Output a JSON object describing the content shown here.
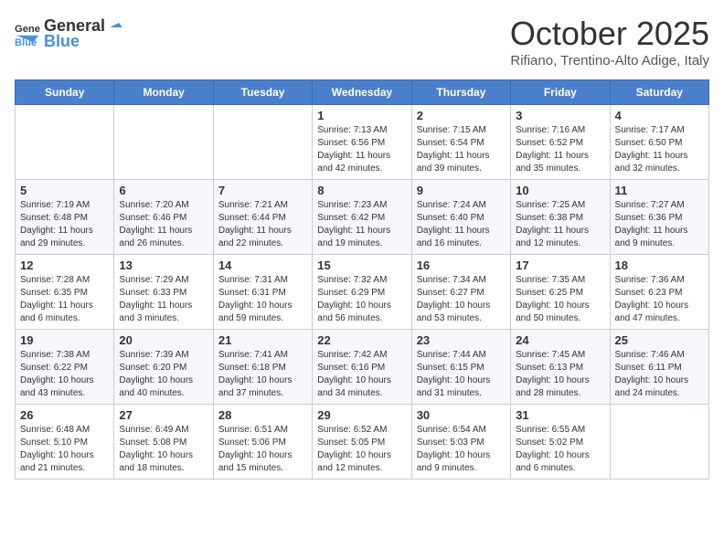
{
  "logo": {
    "general": "General",
    "blue": "Blue"
  },
  "header": {
    "month": "October 2025",
    "location": "Rifiano, Trentino-Alto Adige, Italy"
  },
  "weekdays": [
    "Sunday",
    "Monday",
    "Tuesday",
    "Wednesday",
    "Thursday",
    "Friday",
    "Saturday"
  ],
  "weeks": [
    [
      null,
      null,
      null,
      {
        "day": "1",
        "sunrise": "7:13 AM",
        "sunset": "6:56 PM",
        "daylight": "11 hours and 42 minutes."
      },
      {
        "day": "2",
        "sunrise": "7:15 AM",
        "sunset": "6:54 PM",
        "daylight": "11 hours and 39 minutes."
      },
      {
        "day": "3",
        "sunrise": "7:16 AM",
        "sunset": "6:52 PM",
        "daylight": "11 hours and 35 minutes."
      },
      {
        "day": "4",
        "sunrise": "7:17 AM",
        "sunset": "6:50 PM",
        "daylight": "11 hours and 32 minutes."
      }
    ],
    [
      {
        "day": "5",
        "sunrise": "7:19 AM",
        "sunset": "6:48 PM",
        "daylight": "11 hours and 29 minutes."
      },
      {
        "day": "6",
        "sunrise": "7:20 AM",
        "sunset": "6:46 PM",
        "daylight": "11 hours and 26 minutes."
      },
      {
        "day": "7",
        "sunrise": "7:21 AM",
        "sunset": "6:44 PM",
        "daylight": "11 hours and 22 minutes."
      },
      {
        "day": "8",
        "sunrise": "7:23 AM",
        "sunset": "6:42 PM",
        "daylight": "11 hours and 19 minutes."
      },
      {
        "day": "9",
        "sunrise": "7:24 AM",
        "sunset": "6:40 PM",
        "daylight": "11 hours and 16 minutes."
      },
      {
        "day": "10",
        "sunrise": "7:25 AM",
        "sunset": "6:38 PM",
        "daylight": "11 hours and 12 minutes."
      },
      {
        "day": "11",
        "sunrise": "7:27 AM",
        "sunset": "6:36 PM",
        "daylight": "11 hours and 9 minutes."
      }
    ],
    [
      {
        "day": "12",
        "sunrise": "7:28 AM",
        "sunset": "6:35 PM",
        "daylight": "11 hours and 6 minutes."
      },
      {
        "day": "13",
        "sunrise": "7:29 AM",
        "sunset": "6:33 PM",
        "daylight": "11 hours and 3 minutes."
      },
      {
        "day": "14",
        "sunrise": "7:31 AM",
        "sunset": "6:31 PM",
        "daylight": "10 hours and 59 minutes."
      },
      {
        "day": "15",
        "sunrise": "7:32 AM",
        "sunset": "6:29 PM",
        "daylight": "10 hours and 56 minutes."
      },
      {
        "day": "16",
        "sunrise": "7:34 AM",
        "sunset": "6:27 PM",
        "daylight": "10 hours and 53 minutes."
      },
      {
        "day": "17",
        "sunrise": "7:35 AM",
        "sunset": "6:25 PM",
        "daylight": "10 hours and 50 minutes."
      },
      {
        "day": "18",
        "sunrise": "7:36 AM",
        "sunset": "6:23 PM",
        "daylight": "10 hours and 47 minutes."
      }
    ],
    [
      {
        "day": "19",
        "sunrise": "7:38 AM",
        "sunset": "6:22 PM",
        "daylight": "10 hours and 43 minutes."
      },
      {
        "day": "20",
        "sunrise": "7:39 AM",
        "sunset": "6:20 PM",
        "daylight": "10 hours and 40 minutes."
      },
      {
        "day": "21",
        "sunrise": "7:41 AM",
        "sunset": "6:18 PM",
        "daylight": "10 hours and 37 minutes."
      },
      {
        "day": "22",
        "sunrise": "7:42 AM",
        "sunset": "6:16 PM",
        "daylight": "10 hours and 34 minutes."
      },
      {
        "day": "23",
        "sunrise": "7:44 AM",
        "sunset": "6:15 PM",
        "daylight": "10 hours and 31 minutes."
      },
      {
        "day": "24",
        "sunrise": "7:45 AM",
        "sunset": "6:13 PM",
        "daylight": "10 hours and 28 minutes."
      },
      {
        "day": "25",
        "sunrise": "7:46 AM",
        "sunset": "6:11 PM",
        "daylight": "10 hours and 24 minutes."
      }
    ],
    [
      {
        "day": "26",
        "sunrise": "6:48 AM",
        "sunset": "5:10 PM",
        "daylight": "10 hours and 21 minutes."
      },
      {
        "day": "27",
        "sunrise": "6:49 AM",
        "sunset": "5:08 PM",
        "daylight": "10 hours and 18 minutes."
      },
      {
        "day": "28",
        "sunrise": "6:51 AM",
        "sunset": "5:06 PM",
        "daylight": "10 hours and 15 minutes."
      },
      {
        "day": "29",
        "sunrise": "6:52 AM",
        "sunset": "5:05 PM",
        "daylight": "10 hours and 12 minutes."
      },
      {
        "day": "30",
        "sunrise": "6:54 AM",
        "sunset": "5:03 PM",
        "daylight": "10 hours and 9 minutes."
      },
      {
        "day": "31",
        "sunrise": "6:55 AM",
        "sunset": "5:02 PM",
        "daylight": "10 hours and 6 minutes."
      },
      null
    ]
  ]
}
